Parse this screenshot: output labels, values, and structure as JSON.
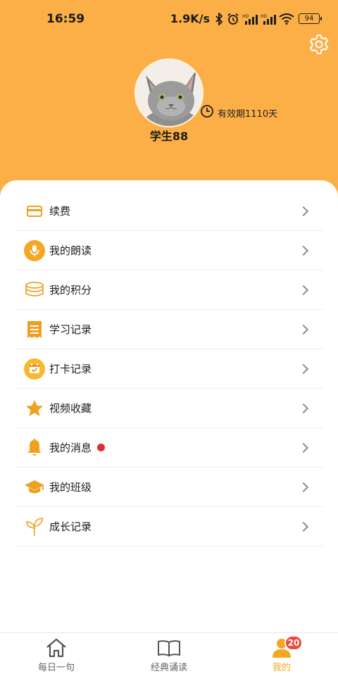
{
  "status_bar": {
    "time": "16:59",
    "speed": "1.9K/s",
    "battery": "94",
    "icons": [
      "bluetooth-icon",
      "alarm-icon",
      "signal-hd-icon",
      "signal-hd-icon",
      "wifi-icon",
      "battery-icon"
    ]
  },
  "profile": {
    "username": "学生88",
    "validity": "有效期1110天"
  },
  "colors": {
    "header": "#fcaf47",
    "accent": "#f5a623",
    "badge": "#e94b3c",
    "dot": "#e32b2b"
  },
  "menu": [
    {
      "label": "续费",
      "icon": "card-icon"
    },
    {
      "label": "我的朗读",
      "icon": "microphone-icon"
    },
    {
      "label": "我的积分",
      "icon": "coins-icon"
    },
    {
      "label": "学习记录",
      "icon": "receipt-icon"
    },
    {
      "label": "打卡记录",
      "icon": "calendar-check-icon"
    },
    {
      "label": "视频收藏",
      "icon": "star-icon"
    },
    {
      "label": "我的消息",
      "icon": "bell-icon",
      "has_dot": true
    },
    {
      "label": "我的班级",
      "icon": "graduation-cap-icon"
    },
    {
      "label": "成长记录",
      "icon": "sprout-icon"
    }
  ],
  "tabbar": {
    "tabs": [
      {
        "label": "每日一句",
        "icon": "home-icon",
        "active": false
      },
      {
        "label": "经典诵读",
        "icon": "book-icon",
        "active": false
      },
      {
        "label": "我的",
        "icon": "user-icon",
        "active": true
      }
    ],
    "badge": "20"
  }
}
